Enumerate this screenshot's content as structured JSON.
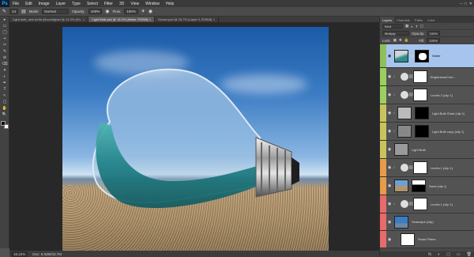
{
  "app": {
    "logo": "Ps"
  },
  "menu": [
    "File",
    "Edit",
    "Image",
    "Layer",
    "Type",
    "Select",
    "Filter",
    "3D",
    "View",
    "Window",
    "Help"
  ],
  "window_controls": [
    "–",
    "□",
    "✕"
  ],
  "options": {
    "brush_size": "14",
    "mode_label": "Mode:",
    "mode_value": "Normal",
    "opacity_label": "Opacity:",
    "opacity_value": "100%",
    "flow_label": "Flow:",
    "flow_value": "100%"
  },
  "tabs": [
    {
      "label": "Light bulb_new turtle (Nov/old)psd @ 14.3% (Sh.. ×",
      "active": false
    },
    {
      "label": "Light Bulb.psd @ 16.2% (Water, RGB/8) ×",
      "active": true
    },
    {
      "label": "Ocean.psd @ 16.7% (Layer 0, RGB/8) ×",
      "active": false
    }
  ],
  "tools": [
    "▸",
    "▭",
    "◯",
    "⌖",
    "✂",
    "✎",
    "⊘",
    "⌫",
    "✦",
    "◐",
    "✒",
    "T",
    "↖",
    "▢",
    "✋",
    "🔍"
  ],
  "status": {
    "zoom": "16.22%",
    "doc": "Doc: 5.93M/33.7M"
  },
  "panel": {
    "tabs": [
      "Layers",
      "Channels",
      "Paths",
      "Color"
    ],
    "kind_label": "Kind",
    "blend_mode": "Multiply",
    "opacity_label": "Opacity:",
    "opacity_value": "100%",
    "lock_label": "Lock:",
    "fill_label": "Fill:",
    "fill_value": "100%"
  },
  "layers": [
    {
      "name": "Water",
      "color": "#8fbf5a",
      "selected": true
    },
    {
      "name": "Brightness/Cont...",
      "color": "#9ccf62",
      "selected": false
    },
    {
      "name": "Levels 2 (clip 1)",
      "color": "#9ccf62",
      "selected": false
    },
    {
      "name": "Light Bulb Shad (clip 1)",
      "color": "#c9c35e",
      "selected": false
    },
    {
      "name": "Light Bulb copy (clip 1)",
      "color": "#c9c35e",
      "selected": false
    },
    {
      "name": "Light Bulb",
      "color": "#c9c35e",
      "selected": false
    },
    {
      "name": "Levels 1 (clip 1)",
      "color": "#e69c4a",
      "selected": false
    },
    {
      "name": "Sand (clip 1)",
      "color": "#e69c4a",
      "selected": false
    },
    {
      "name": "Levels 1 (clip 1)",
      "color": "#e86a6a",
      "selected": false
    },
    {
      "name": "Seascape (clip)",
      "color": "#e86a6a",
      "selected": false
    },
    {
      "name": "Smart Filters",
      "color": "#e86a6a",
      "selected": false
    }
  ],
  "panel_bottom_icons": [
    "fx",
    "◐",
    "▢",
    "▭",
    "🗑"
  ]
}
